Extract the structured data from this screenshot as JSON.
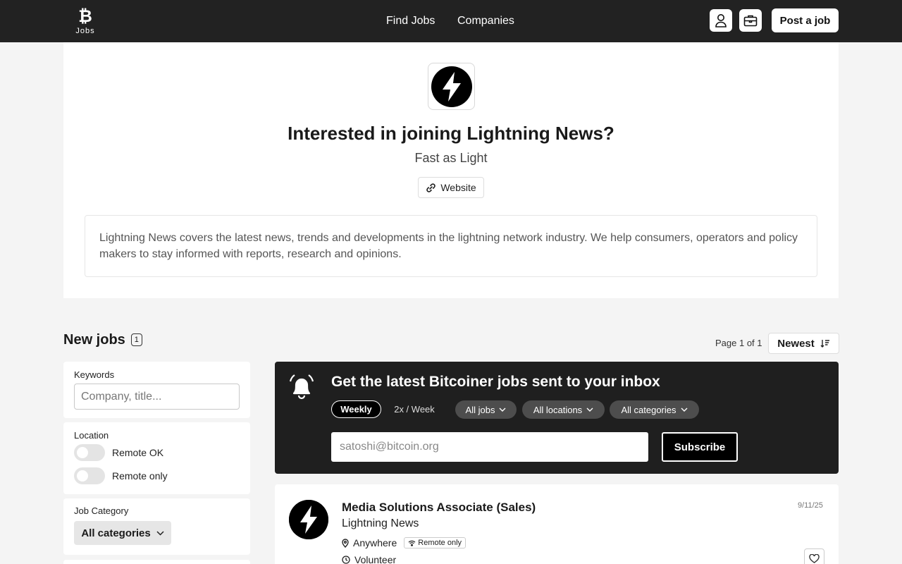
{
  "nav": {
    "logo_text": "Jobs",
    "logo_symbol": "₿",
    "find_jobs": "Find Jobs",
    "companies": "Companies",
    "post_job": "Post a job",
    "icons": [
      "user-icon",
      "briefcase-icon"
    ]
  },
  "company": {
    "title": "Interested in joining Lightning News?",
    "tagline": "Fast as Light",
    "website_label": "Website",
    "description": "Lightning News covers the latest news, trends and developments in the lightning network industry. We help consumers, operators and policy makers to stay informed with reports, research and opinions."
  },
  "jobs": {
    "title": "New jobs",
    "count": "1",
    "page_info": "Page 1 of 1",
    "sort_label": "Newest"
  },
  "filters": {
    "keywords_label": "Keywords",
    "keywords_placeholder": "Company, title...",
    "location_label": "Location",
    "remote_ok": "Remote OK",
    "remote_only": "Remote only",
    "category_label": "Job Category",
    "category_value": "All categories"
  },
  "subscribe": {
    "title": "Get the latest Bitcoiner jobs sent to your inbox",
    "freq_weekly": "Weekly",
    "freq_twice": "2x / Week",
    "jobs_filter": "All jobs",
    "locations_filter": "All locations",
    "categories_filter": "All categories",
    "email_placeholder": "satoshi@bitcoin.org",
    "button": "Subscribe"
  },
  "job_list": [
    {
      "title": "Media Solutions Associate (Sales)",
      "company": "Lightning News",
      "location": "Anywhere",
      "remote_badge": "Remote only",
      "type": "Volunteer",
      "date": "9/11/25"
    }
  ],
  "colors": {
    "nav_bg": "#222222",
    "banner_bg": "#1f1f1f",
    "page_bg": "#f4f4f4"
  }
}
